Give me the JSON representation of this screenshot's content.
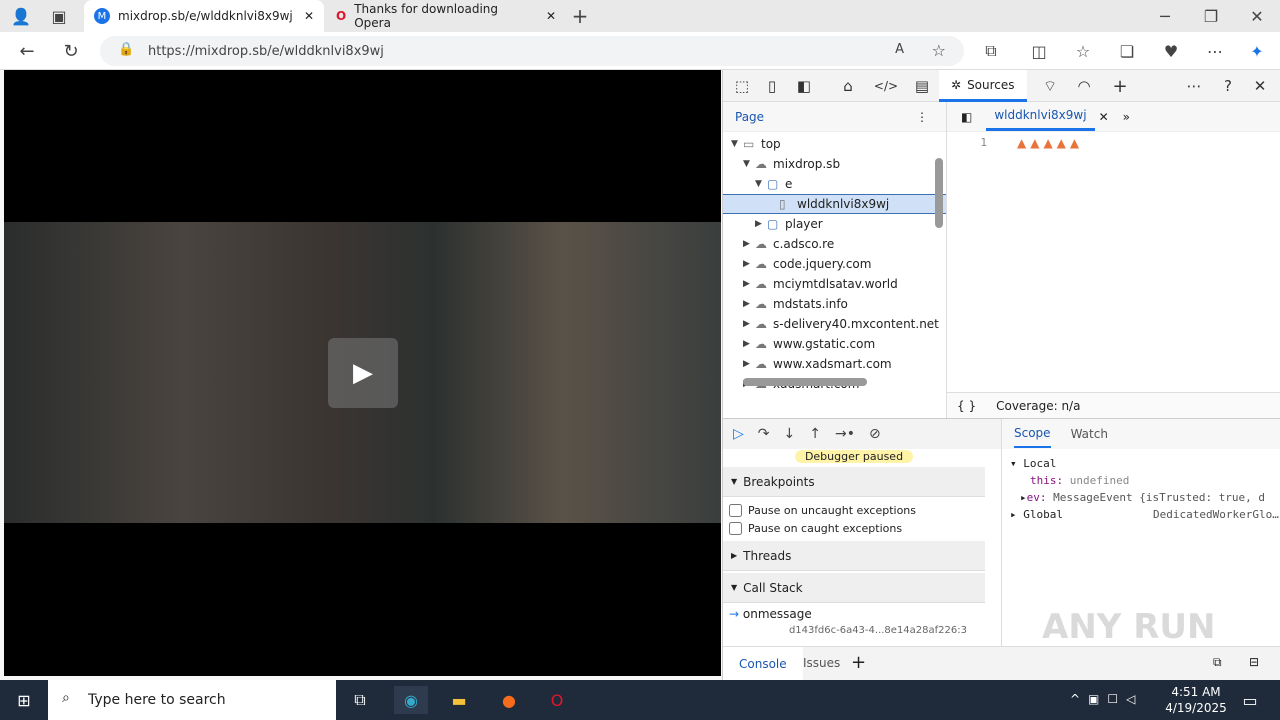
{
  "browser": {
    "tabs": [
      {
        "title": "mixdrop.sb/e/wlddknlvi8x9wj",
        "icon": "M"
      },
      {
        "title": "Thanks for downloading Opera",
        "icon": "O"
      }
    ],
    "url": "https://mixdrop.sb/e/wlddknlvi8x9wj"
  },
  "devtools": {
    "active_tab": "Sources",
    "nav_tab": "Page",
    "file_tab": "wlddknlvi8x9wj",
    "tree": [
      {
        "label": "top",
        "depth": 0,
        "open": true,
        "icon": "window"
      },
      {
        "label": "mixdrop.sb",
        "depth": 1,
        "open": true,
        "icon": "cloud"
      },
      {
        "label": "e",
        "depth": 2,
        "open": true,
        "icon": "folder"
      },
      {
        "label": "wlddknlvi8x9wj",
        "depth": 3,
        "icon": "file",
        "selected": true
      },
      {
        "label": "player",
        "depth": 2,
        "open": false,
        "icon": "folder"
      },
      {
        "label": "c.adsco.re",
        "depth": 1,
        "open": false,
        "icon": "cloud"
      },
      {
        "label": "code.jquery.com",
        "depth": 1,
        "open": false,
        "icon": "cloud"
      },
      {
        "label": "mciymtdlsatav.world",
        "depth": 1,
        "open": false,
        "icon": "cloud"
      },
      {
        "label": "mdstats.info",
        "depth": 1,
        "open": false,
        "icon": "cloud"
      },
      {
        "label": "s-delivery40.mxcontent.net",
        "depth": 1,
        "open": false,
        "icon": "cloud"
      },
      {
        "label": "www.gstatic.com",
        "depth": 1,
        "open": false,
        "icon": "cloud"
      },
      {
        "label": "www.xadsmart.com",
        "depth": 1,
        "open": false,
        "icon": "cloud"
      },
      {
        "label": "xadsmart.com",
        "depth": 1,
        "open": false,
        "icon": "cloud"
      }
    ],
    "line_number": "1",
    "coverage": "Coverage: n/a",
    "format_label": "{ }",
    "paused": "Debugger paused",
    "breakpoints": "Breakpoints",
    "pause_uncaught": "Pause on uncaught exceptions",
    "pause_caught": "Pause on caught exceptions",
    "threads": "Threads",
    "call_stack": "Call Stack",
    "frame": "onmessage",
    "frame_loc": "d143fd6c-6a43-4...8e14a28af226:3",
    "scope_tab": "Scope",
    "watch_tab": "Watch",
    "local": "Local",
    "this_key": "this:",
    "this_val": "undefined",
    "ev_key": "ev:",
    "ev_val": "MessageEvent {isTrusted: true, d",
    "global": "Global",
    "global_val": "DedicatedWorkerGlo…",
    "console_tab": "Console",
    "issues_tab": "Issues"
  },
  "taskbar": {
    "search_placeholder": "Type here to search",
    "time": "4:51 AM",
    "date": "4/19/2025"
  },
  "watermark": "ANY RUN"
}
